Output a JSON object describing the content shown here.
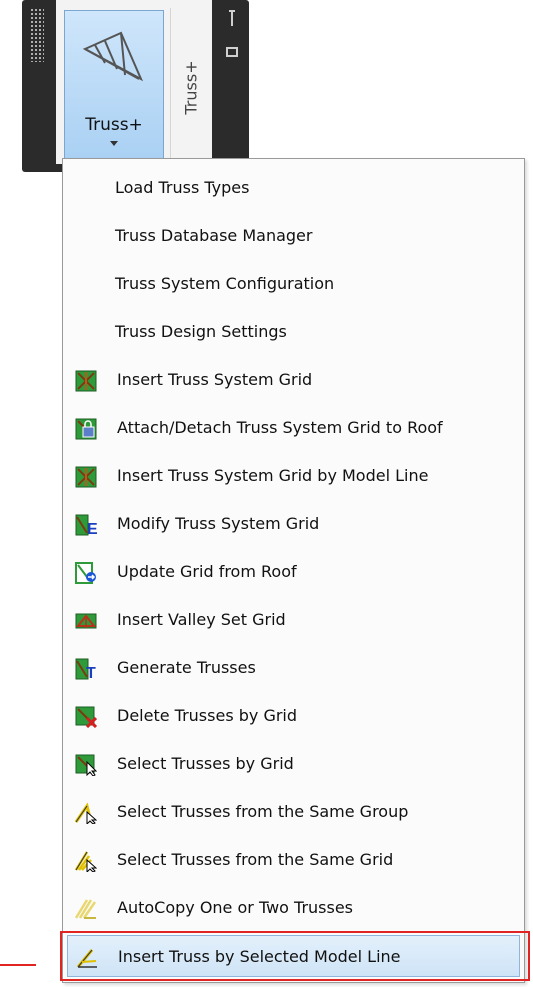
{
  "ribbon": {
    "button_label": "Truss+",
    "panel_label": "Truss+"
  },
  "menu": {
    "items": [
      {
        "label": "Load Truss Types",
        "icon": "none"
      },
      {
        "label": "Truss Database Manager",
        "icon": "none"
      },
      {
        "label": "Truss System Configuration",
        "icon": "none"
      },
      {
        "label": "Truss Design Settings",
        "icon": "none"
      },
      {
        "label": "Insert Truss System Grid",
        "icon": "grid-icon"
      },
      {
        "label": "Attach/Detach Truss System Grid to Roof",
        "icon": "grid-attach-icon"
      },
      {
        "label": "Insert Truss System Grid by Model Line",
        "icon": "grid-icon"
      },
      {
        "label": "Modify Truss System Grid",
        "icon": "grid-modify-icon"
      },
      {
        "label": "Update Grid from Roof",
        "icon": "grid-update-icon"
      },
      {
        "label": "Insert Valley Set Grid",
        "icon": "valley-grid-icon"
      },
      {
        "label": "Generate Trusses",
        "icon": "generate-trusses-icon"
      },
      {
        "label": "Delete Trusses by Grid",
        "icon": "delete-trusses-icon"
      },
      {
        "label": "Select Trusses by Grid",
        "icon": "select-grid-icon"
      },
      {
        "label": "Select Trusses from the Same Group",
        "icon": "select-group-icon"
      },
      {
        "label": "Select Trusses from the Same Grid",
        "icon": "select-same-grid-icon"
      },
      {
        "label": "AutoCopy One or Two Trusses",
        "icon": "autocopy-icon"
      },
      {
        "label": "Insert Truss by Selected Model Line",
        "icon": "insert-by-line-icon"
      }
    ]
  },
  "colors": {
    "highlight_border": "#e02424",
    "ribbon_dark": "#2b2b2b",
    "button_blue": "#a9d0f3"
  }
}
